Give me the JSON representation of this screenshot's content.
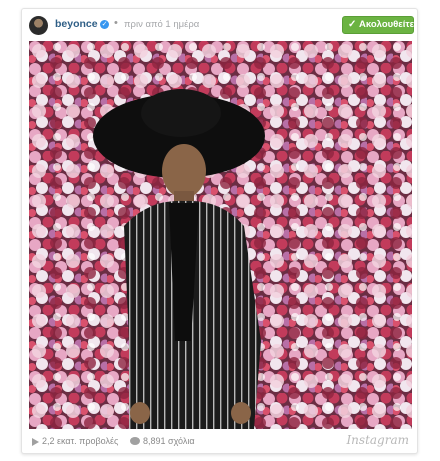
{
  "post": {
    "username": "beyonce",
    "timestamp": "πριν από 1 ημέρα",
    "follow_label": "Ακολουθείτε",
    "views": "2,2 εκατ. προβολές",
    "comments": "8,891 σχόλια",
    "brand": "Instagram"
  },
  "icons": {
    "verified": "verified-badge-icon",
    "follow": "check-icon",
    "views": "play-icon",
    "comments": "comment-bubble-icon"
  },
  "colors": {
    "username": "#2e5e86",
    "follow_button": "#6bb342",
    "verified": "#3897f0",
    "meta_text": "#8a8a8a"
  }
}
